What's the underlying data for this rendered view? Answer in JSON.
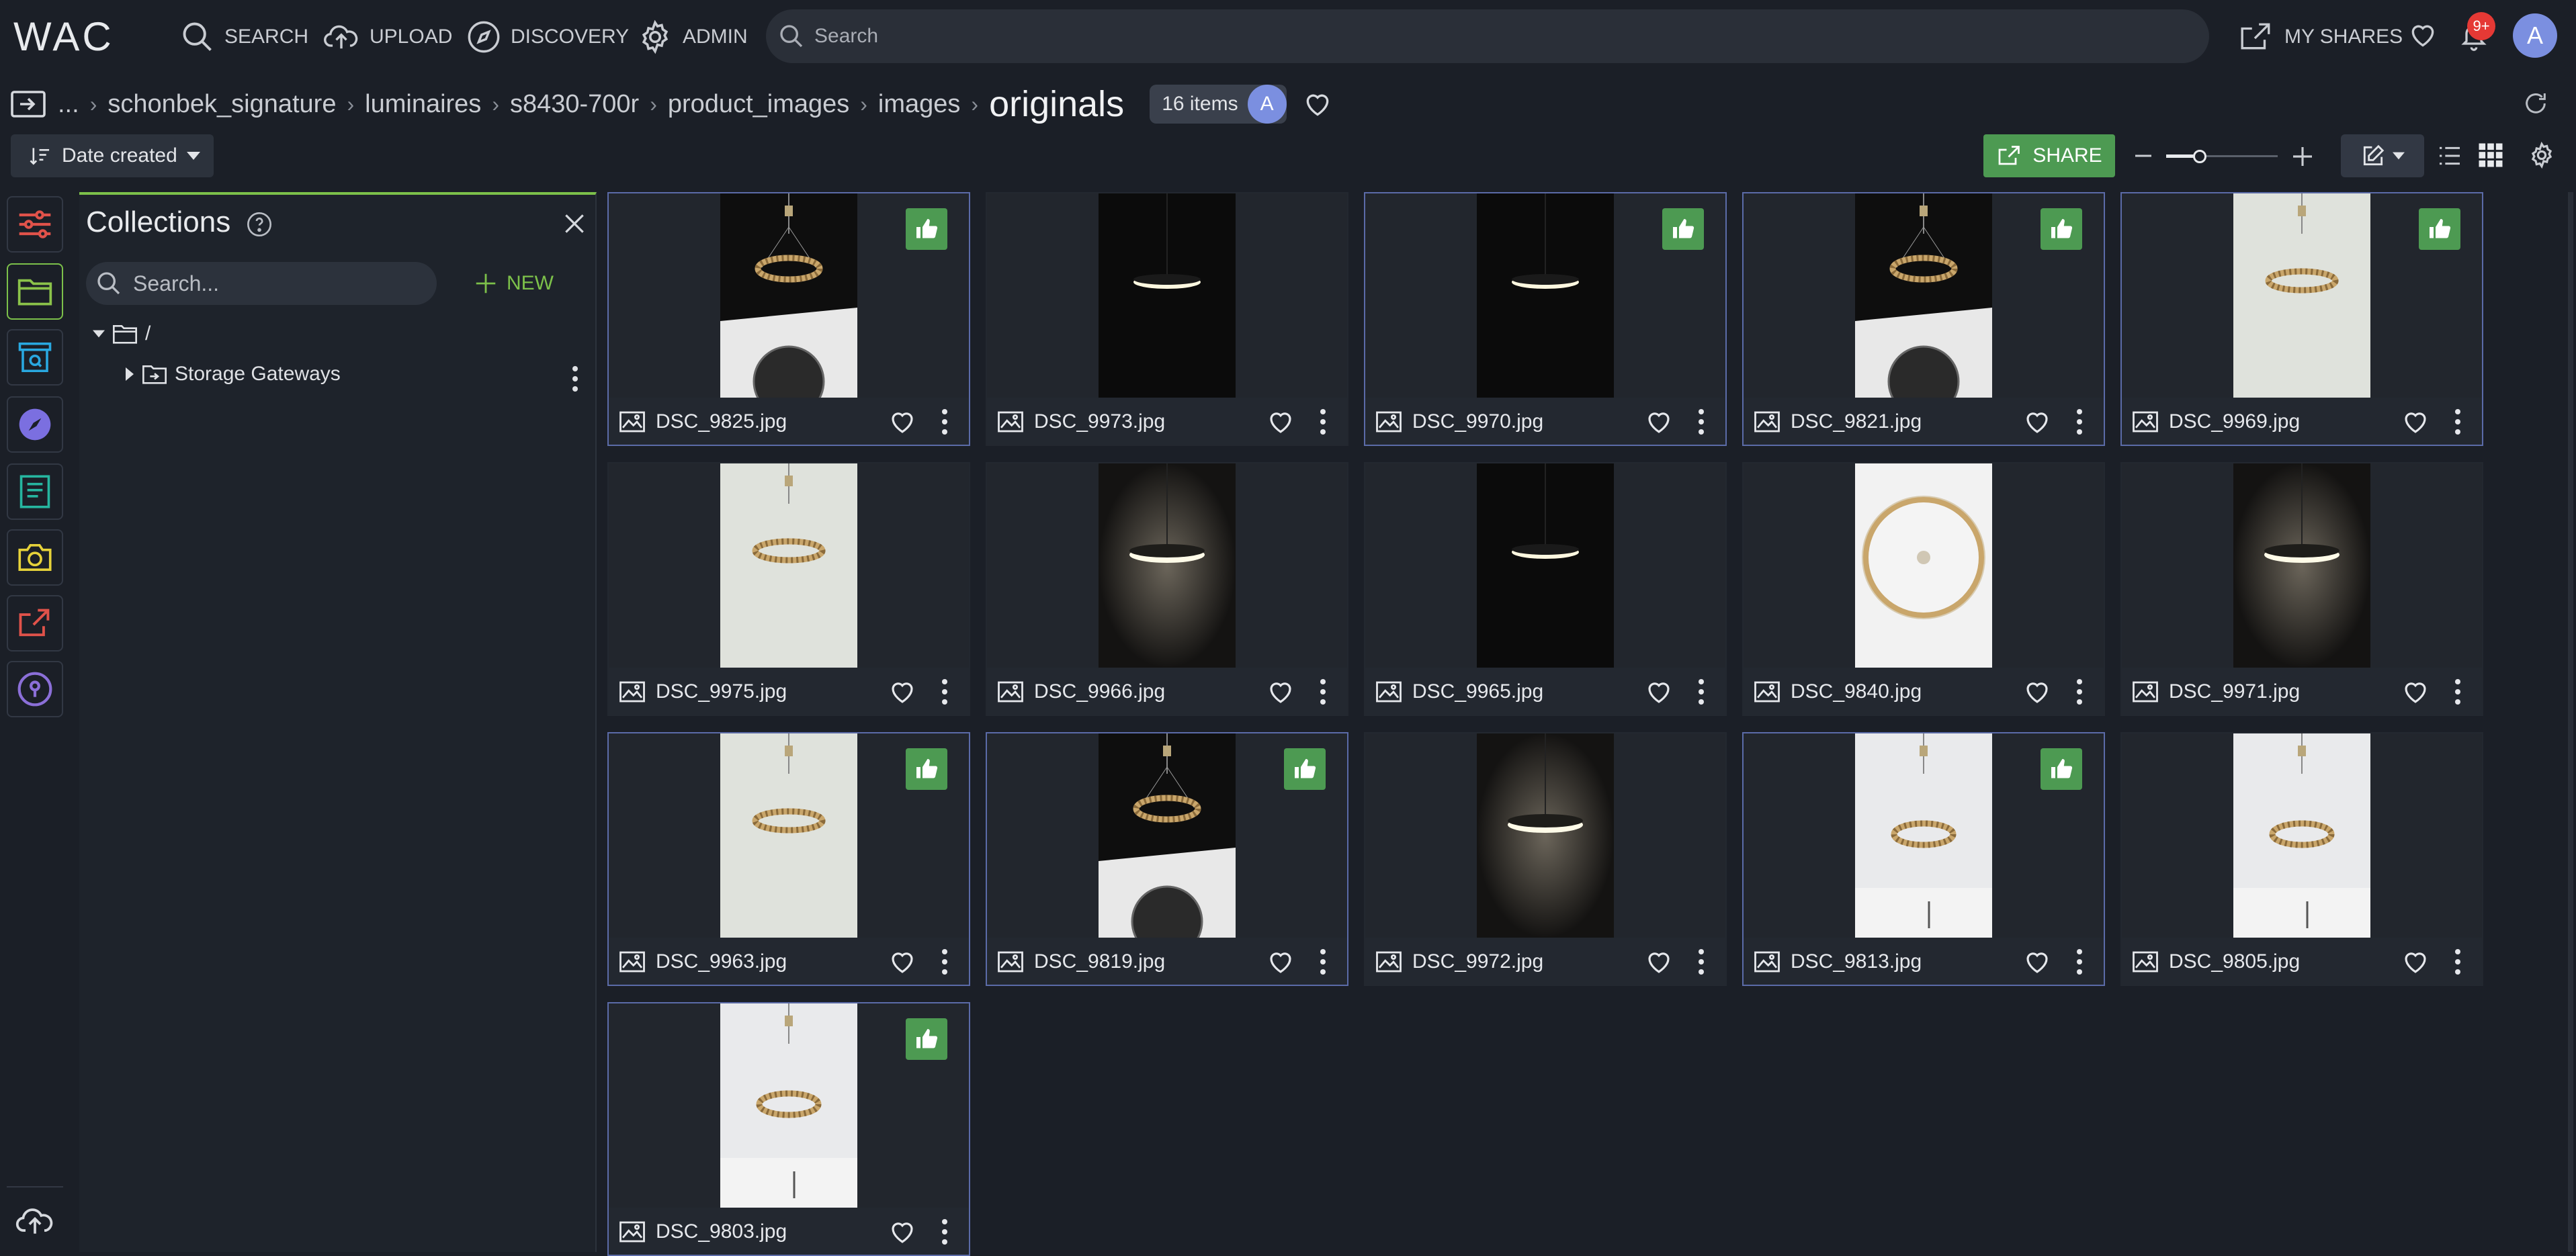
{
  "app": {
    "logo": "WAC"
  },
  "nav": {
    "search": "SEARCH",
    "upload": "UPLOAD",
    "discovery": "DISCOVERY",
    "admin": "ADMIN"
  },
  "global_search": {
    "placeholder": "Search"
  },
  "header_right": {
    "my_shares": "MY SHARES",
    "notifications_count": "9+",
    "avatar_initial": "A"
  },
  "breadcrumb": {
    "ellipsis": "...",
    "items": [
      "schonbek_signature",
      "luminaires",
      "s8430-700r",
      "product_images",
      "images"
    ],
    "current": "originals",
    "item_count": "16 items",
    "owner_initial": "A"
  },
  "toolbar": {
    "sort_label": "Date created",
    "share_label": "SHARE"
  },
  "collections": {
    "title": "Collections",
    "search_placeholder": "Search...",
    "new_label": "NEW",
    "root_label": "/",
    "child_label": "Storage Gateways"
  },
  "rail_colors": {
    "filters": "#e0524a",
    "folders": "#8bc34a",
    "archive": "#29a8e0",
    "discover": "#7b6fe0",
    "docs": "#26b6a0",
    "camera": "#e6d23a",
    "share": "#e0524a",
    "vault": "#8b6fd8"
  },
  "assets": [
    {
      "name": "DSC_9825.jpg",
      "liked": true,
      "selected": true,
      "style": "dark-chandelier"
    },
    {
      "name": "DSC_9973.jpg",
      "liked": false,
      "selected": false,
      "style": "dark-ring"
    },
    {
      "name": "DSC_9970.jpg",
      "liked": true,
      "selected": true,
      "style": "dark-ring"
    },
    {
      "name": "DSC_9821.jpg",
      "liked": true,
      "selected": true,
      "style": "dark-chandelier"
    },
    {
      "name": "DSC_9969.jpg",
      "liked": true,
      "selected": true,
      "style": "light-chandelier"
    },
    {
      "name": "DSC_9975.jpg",
      "liked": false,
      "selected": false,
      "style": "light-chandelier"
    },
    {
      "name": "DSC_9966.jpg",
      "liked": false,
      "selected": false,
      "style": "glow-ring"
    },
    {
      "name": "DSC_9965.jpg",
      "liked": false,
      "selected": false,
      "style": "dark-ring"
    },
    {
      "name": "DSC_9840.jpg",
      "liked": false,
      "selected": false,
      "style": "top-view"
    },
    {
      "name": "DSC_9971.jpg",
      "liked": false,
      "selected": false,
      "style": "glow-ring"
    },
    {
      "name": "DSC_9963.jpg",
      "liked": true,
      "selected": true,
      "style": "light-chandelier"
    },
    {
      "name": "DSC_9819.jpg",
      "liked": true,
      "selected": true,
      "style": "dark-chandelier"
    },
    {
      "name": "DSC_9972.jpg",
      "liked": false,
      "selected": false,
      "style": "glow-ring"
    },
    {
      "name": "DSC_9813.jpg",
      "liked": true,
      "selected": true,
      "style": "bright-chandelier"
    },
    {
      "name": "DSC_9805.jpg",
      "liked": false,
      "selected": false,
      "style": "bright-chandelier"
    },
    {
      "name": "DSC_9803.jpg",
      "liked": true,
      "selected": true,
      "style": "bright-chandelier"
    }
  ]
}
